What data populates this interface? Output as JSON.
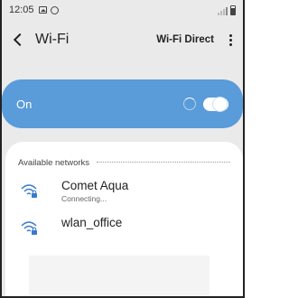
{
  "status_bar": {
    "time": "12:05",
    "icons": [
      "gallery-icon",
      "whatsapp-icon",
      "signal-icon",
      "battery-icon"
    ]
  },
  "header": {
    "title": "Wi-Fi",
    "wifi_direct_label": "Wi-Fi Direct",
    "back_icon": "chevron-left-icon",
    "more_icon": "more-vertical-icon"
  },
  "master_toggle": {
    "label": "On",
    "state": "on",
    "scanning": true
  },
  "networks": {
    "section_title": "Available networks",
    "items": [
      {
        "name": "Comet Aqua",
        "status": "Connecting...",
        "icon": "wifi-locked-icon"
      },
      {
        "name": "wlan_office",
        "status": "",
        "icon": "wifi-locked-icon"
      }
    ]
  },
  "colors": {
    "accent": "#5a9bd9",
    "background": "#eaeaea",
    "card": "#ffffff",
    "icon": "#3a7ac9"
  }
}
